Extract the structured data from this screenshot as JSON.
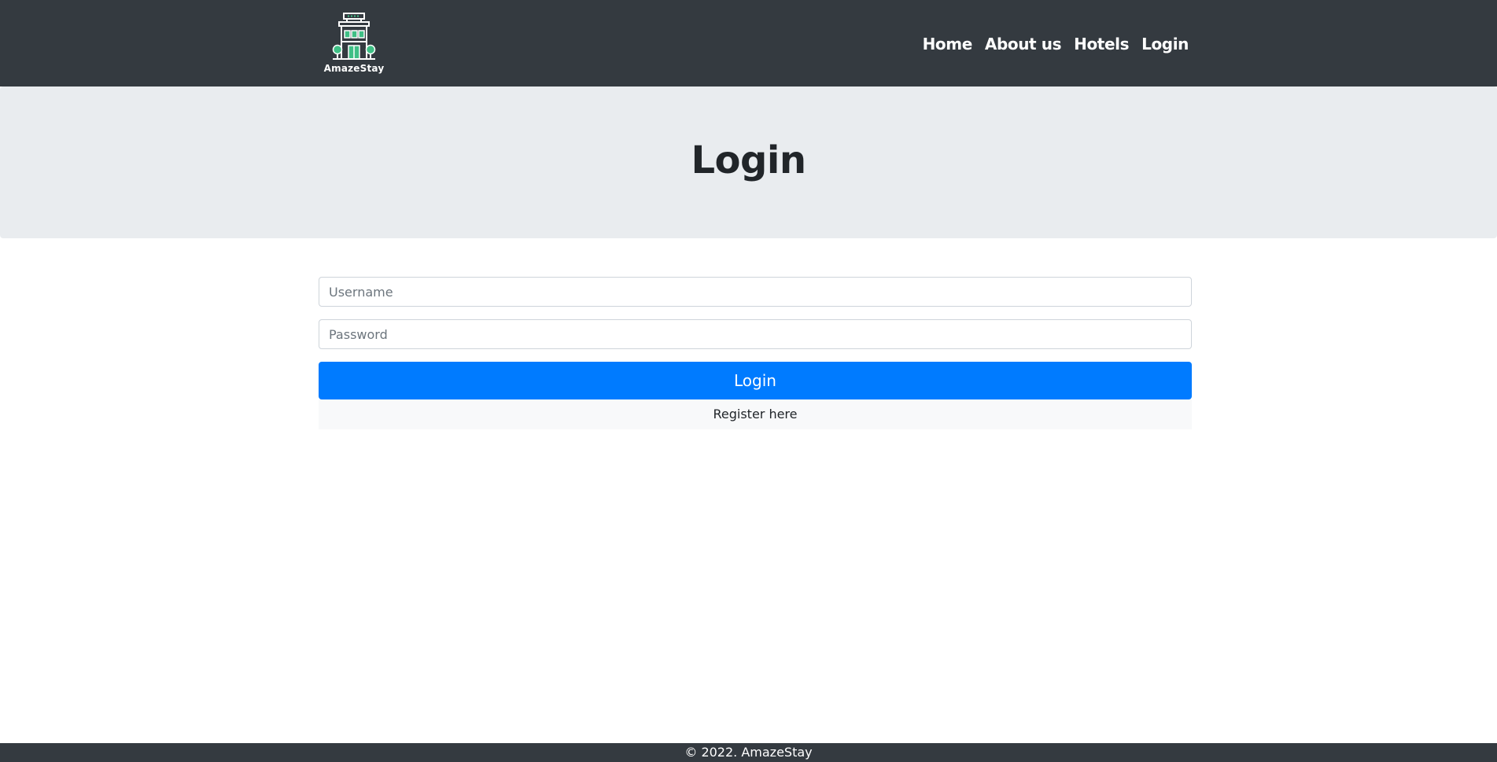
{
  "brand": {
    "name": "AmazeStay",
    "logo_icon": "hotel-building-icon",
    "accent_color": "#3fbf85"
  },
  "nav": {
    "items": [
      {
        "label": "Home"
      },
      {
        "label": "About us"
      },
      {
        "label": "Hotels"
      },
      {
        "label": "Login"
      }
    ]
  },
  "hero": {
    "title": "Login"
  },
  "form": {
    "username_placeholder": "Username",
    "username_value": "",
    "password_placeholder": "Password",
    "password_value": "",
    "submit_label": "Login",
    "register_label": "Register here"
  },
  "footer": {
    "text": "© 2022. AmazeStay"
  },
  "colors": {
    "navbar": "#343a40",
    "hero": "#e9ecef",
    "primary": "#007bff",
    "register_bg": "#f8f9fa"
  }
}
